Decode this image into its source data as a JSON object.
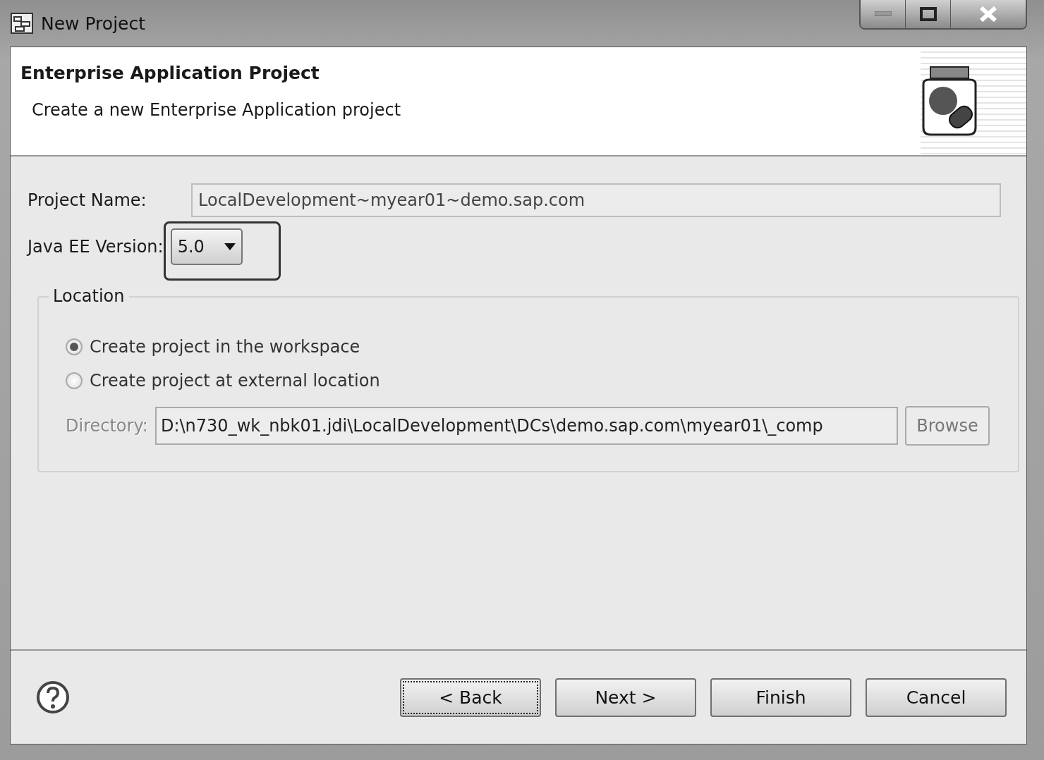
{
  "window": {
    "title": "New Project"
  },
  "header": {
    "title": "Enterprise Application Project",
    "description": "Create a new Enterprise Application project"
  },
  "form": {
    "project_name": {
      "label": "Project Name:",
      "value": "LocalDevelopment~myear01~demo.sap.com"
    },
    "java_ee_version": {
      "label": "Java EE Version:",
      "value": "5.0",
      "highlighted": true
    }
  },
  "location": {
    "title": "Location",
    "options": [
      {
        "label": "Create project in the workspace",
        "selected": true
      },
      {
        "label": "Create project at external location",
        "selected": false
      }
    ],
    "directory": {
      "label": "Directory:",
      "value": "D:\\n730_wk_nbk01.jdi\\LocalDevelopment\\DCs\\demo.sap.com\\myear01\\_comp",
      "disabled": true
    },
    "browse": {
      "label": "Browse",
      "disabled": true
    }
  },
  "buttons": [
    {
      "label": "< Back",
      "focused": true
    },
    {
      "label": "Next >",
      "focused": false
    },
    {
      "label": "Finish",
      "focused": false
    },
    {
      "label": "Cancel",
      "focused": false
    }
  ]
}
